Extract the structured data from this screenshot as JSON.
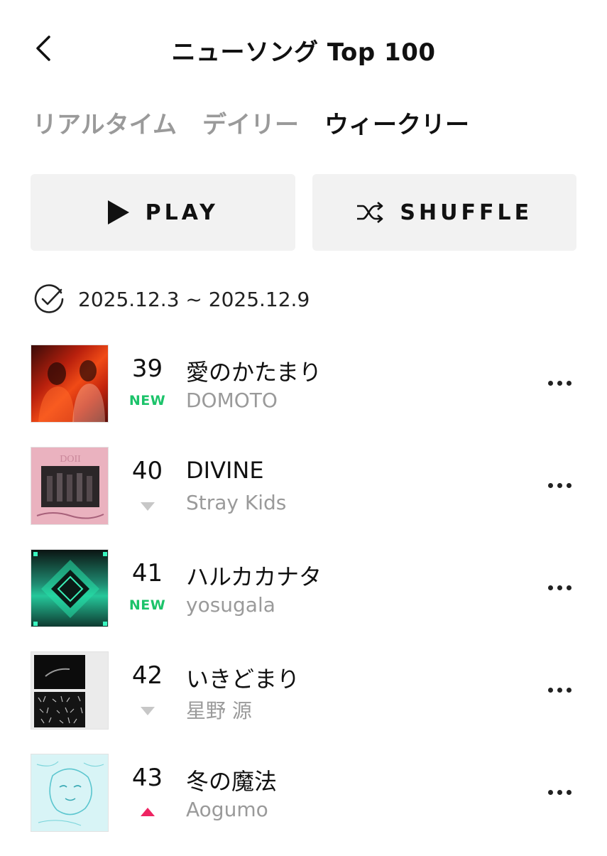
{
  "header": {
    "title": "ニューソング Top 100"
  },
  "tabs": [
    {
      "label": "リアルタイム",
      "active": false
    },
    {
      "label": "デイリー",
      "active": false
    },
    {
      "label": "ウィークリー",
      "active": true
    }
  ],
  "actions": {
    "play_label": "PLAY",
    "shuffle_label": "SHUFFLE"
  },
  "date_range": "2025.12.3 ~ 2025.12.9",
  "songs": [
    {
      "rank": "39",
      "status": "NEW",
      "title": "愛のかたまり",
      "artist": "DOMOTO",
      "cover": "red-duo-portrait"
    },
    {
      "rank": "40",
      "status": "down",
      "title": "DIVINE",
      "artist": "Stray Kids",
      "cover": "pink-group-photo"
    },
    {
      "rank": "41",
      "status": "NEW",
      "title": "ハルカカナタ",
      "artist": "yosugala",
      "cover": "teal-diamond"
    },
    {
      "rank": "42",
      "status": "down",
      "title": "いきどまり",
      "artist": "星野 源",
      "cover": "black-two-panel"
    },
    {
      "rank": "43",
      "status": "up",
      "title": "冬の魔法",
      "artist": "Aogumo",
      "cover": "light-blue-sketch"
    }
  ],
  "colors": {
    "new_badge": "#1cc36a",
    "rank_up": "#ee2462",
    "rank_down": "#c7c7c7",
    "button_bg": "#f2f2f2",
    "inactive_tab": "#9a9a9a"
  }
}
